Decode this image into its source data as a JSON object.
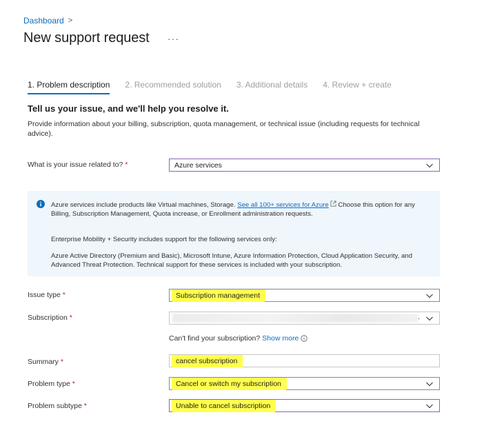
{
  "breadcrumb": {
    "dashboard": "Dashboard",
    "separator": ">"
  },
  "page": {
    "title": "New support request",
    "more": "···"
  },
  "tabs": [
    {
      "label": "1. Problem description",
      "active": true
    },
    {
      "label": "2. Recommended solution",
      "active": false
    },
    {
      "label": "3. Additional details",
      "active": false
    },
    {
      "label": "4. Review + create",
      "active": false
    }
  ],
  "section": {
    "heading": "Tell us your issue, and we'll help you resolve it.",
    "description": "Provide information about your billing, subscription, quota management, or technical issue (including requests for technical advice)."
  },
  "issue_related": {
    "label": "What is your issue related to?",
    "required": "*",
    "value": "Azure services"
  },
  "info": {
    "p1_before": "Azure services include products like Virtual machines, Storage. ",
    "p1_link": "See all 100+ services for Azure",
    "p1_after": " Choose this option for any Billing, Subscription Management, Quota increase, or Enrollment administration requests.",
    "p2": "Enterprise Mobility + Security includes support for the following services only:",
    "p3": "Azure Active Directory (Premium and Basic), Microsoft Intune, Azure Information Protection, Cloud Application Security, and Advanced Threat Protection. Technical support for these services is included with your subscription."
  },
  "issue_type": {
    "label": "Issue type",
    "required": "*",
    "value": "Subscription management"
  },
  "subscription": {
    "label": "Subscription",
    "required": "*",
    "value": "",
    "trailing": "."
  },
  "cant_find": {
    "text": "Can't find your subscription?",
    "link": "Show more"
  },
  "summary": {
    "label": "Summary",
    "required": "*",
    "value": "cancel subscription"
  },
  "problem_type": {
    "label": "Problem type",
    "required": "*",
    "value": "Cancel or switch my subscription"
  },
  "problem_subtype": {
    "label": "Problem subtype",
    "required": "*",
    "value": "Unable to cancel subscription"
  },
  "colors": {
    "accent": "#0f6cbd",
    "highlight": "#ffff4d",
    "info_bg": "#eff6fc",
    "focus_border": "#8764b8"
  }
}
